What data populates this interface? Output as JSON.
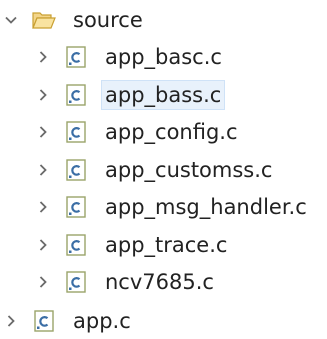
{
  "tree": {
    "folder": {
      "label": "source",
      "expanded": true,
      "icon": "open-folder-icon"
    },
    "children": [
      {
        "label": "app_basc.c",
        "icon": "c-file-icon",
        "selected": false
      },
      {
        "label": "app_bass.c",
        "icon": "c-file-icon",
        "selected": true
      },
      {
        "label": "app_config.c",
        "icon": "c-file-icon",
        "selected": false
      },
      {
        "label": "app_customss.c",
        "icon": "c-file-icon",
        "selected": false
      },
      {
        "label": "app_msg_handler.c",
        "icon": "c-file-icon",
        "selected": false
      },
      {
        "label": "app_trace.c",
        "icon": "c-file-icon",
        "selected": false
      },
      {
        "label": "ncv7685.c",
        "icon": "c-file-icon",
        "selected": false
      }
    ],
    "root_files": [
      {
        "label": "app.c",
        "icon": "c-file-icon"
      }
    ]
  },
  "colors": {
    "chevron": "#6a6a6a",
    "folder_fill": "#f5d17a",
    "folder_stroke": "#c9a032",
    "file_border": "#9aa46a",
    "file_letter": "#3b6ea5",
    "selected_bg": "#e8f1fb"
  }
}
